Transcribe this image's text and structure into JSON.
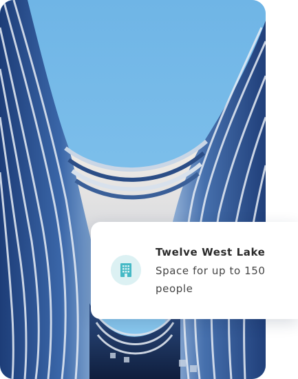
{
  "card": {
    "title": "Twelve West Lake",
    "subtitle": "Space for up to 150 people",
    "icon": "building-icon",
    "icon_color": "#45b9c5",
    "icon_bg": "#dcf1f3"
  },
  "photo": {
    "subject": "modern-architecture-icon"
  }
}
